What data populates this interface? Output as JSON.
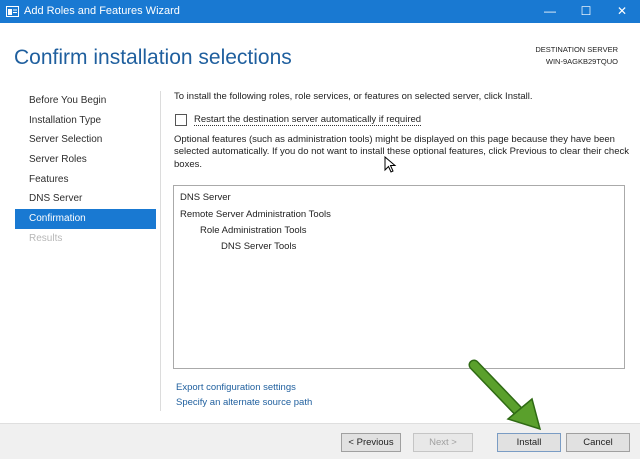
{
  "window": {
    "title": "Add Roles and Features Wizard",
    "controls": {
      "minimize": "—",
      "maximize": "☐",
      "close": "✕"
    }
  },
  "header": {
    "page_title": "Confirm installation selections",
    "destination_label": "DESTINATION SERVER",
    "destination_server": "WIN-9AGKB29TQUO"
  },
  "nav": {
    "items": [
      {
        "label": "Before You Begin",
        "state": "normal"
      },
      {
        "label": "Installation Type",
        "state": "normal"
      },
      {
        "label": "Server Selection",
        "state": "normal"
      },
      {
        "label": "Server Roles",
        "state": "normal"
      },
      {
        "label": "Features",
        "state": "normal"
      },
      {
        "label": "DNS Server",
        "state": "normal"
      },
      {
        "label": "Confirmation",
        "state": "active"
      },
      {
        "label": "Results",
        "state": "disabled"
      }
    ]
  },
  "main": {
    "intro": "To install the following roles, role services, or features on selected server, click Install.",
    "restart_checkbox": {
      "label": "Restart the destination server automatically if required",
      "checked": false
    },
    "optional_text": "Optional features (such as administration tools) might be displayed on this page because they have been selected automatically. If you do not want to install these optional features, click Previous to clear their check boxes.",
    "selections": [
      {
        "label": "DNS Server",
        "level": 0
      },
      {
        "label": "Remote Server Administration Tools",
        "level": 0
      },
      {
        "label": "Role Administration Tools",
        "level": 1
      },
      {
        "label": "DNS Server Tools",
        "level": 2
      }
    ],
    "links": {
      "export": "Export configuration settings",
      "alternate_source": "Specify an alternate source path"
    }
  },
  "footer": {
    "previous": "< Previous",
    "next": "Next >",
    "install": "Install",
    "cancel": "Cancel"
  },
  "colors": {
    "accent": "#1979d2",
    "title": "#1f5f9e",
    "annotation_arrow": "#5aa02c"
  }
}
